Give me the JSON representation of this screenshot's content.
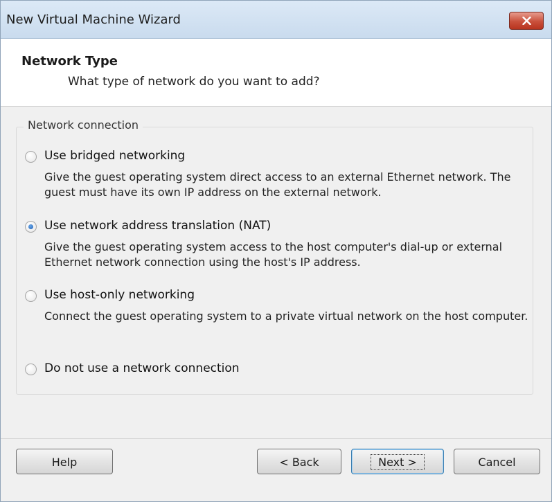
{
  "window": {
    "title": "New Virtual Machine Wizard",
    "close_icon": "close-icon",
    "close_color": "#c9503b"
  },
  "header": {
    "title": "Network Type",
    "subtitle": "What type of network do you want to add?"
  },
  "network_group": {
    "legend": "Network connection",
    "options": [
      {
        "label": "Use bridged networking",
        "description": "Give the guest operating system direct access to an external Ethernet network. The guest must have its own IP address on the external network.",
        "selected": false
      },
      {
        "label": "Use network address translation (NAT)",
        "description": "Give the guest operating system access to the host computer's dial-up or external Ethernet network connection using the host's IP address.",
        "selected": true
      },
      {
        "label": "Use host-only networking",
        "description": "Connect the guest operating system to a private virtual network on the host computer.",
        "selected": false
      },
      {
        "label": "Do not use a network connection",
        "description": "",
        "selected": false
      }
    ]
  },
  "footer": {
    "help_label": "Help",
    "back_label": "< Back",
    "next_label": "Next >",
    "cancel_label": "Cancel"
  }
}
